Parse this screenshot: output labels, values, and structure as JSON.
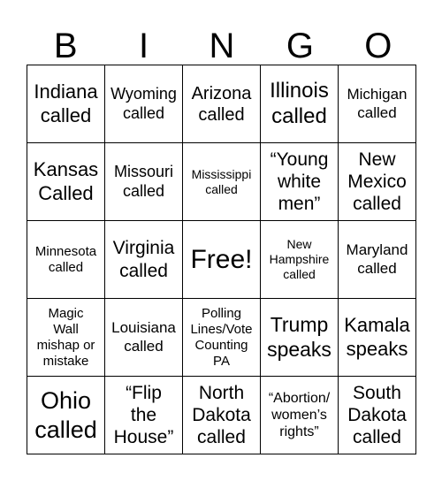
{
  "title_letters": [
    "B",
    "I",
    "N",
    "G",
    "O"
  ],
  "cells": [
    "Indiana\ncalled",
    "Wyoming\ncalled",
    "Arizona\ncalled",
    "Illinois\ncalled",
    "Michigan\ncalled",
    "Kansas\nCalled",
    "Missouri\ncalled",
    "Mississippi\ncalled",
    "“Young\nwhite\nmen”",
    "New\nMexico\ncalled",
    "Minnesota\ncalled",
    "Virginia\ncalled",
    "Free!",
    "New\nHampshire\ncalled",
    "Maryland\ncalled",
    "Magic\nWall\nmishap or\nmistake",
    "Louisiana\ncalled",
    "Polling\nLines/Vote\nCounting\nPA",
    "Trump\nspeaks",
    "Kamala\nspeaks",
    "Ohio\ncalled",
    "“Flip\nthe\nHouse”",
    "North\nDakota\ncalled",
    "“Abortion/\nwomen’s\nrights”",
    "South\nDakota\ncalled"
  ]
}
